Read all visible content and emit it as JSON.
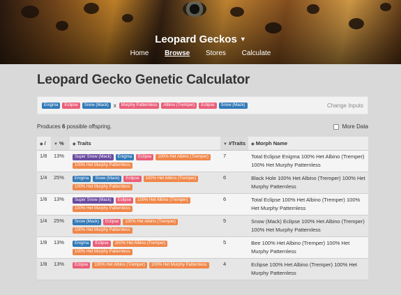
{
  "header": {
    "title": "Leopard Geckos",
    "nav": [
      "Home",
      "Browse",
      "Stores",
      "Calculate"
    ],
    "active": "Browse"
  },
  "page_title": "Leopard Gecko Genetic Calculator",
  "inputs": {
    "parent1": [
      {
        "label": "Enigma",
        "color": "#337ab7"
      },
      {
        "label": "Eclipse",
        "color": "#ea5f79"
      },
      {
        "label": "Snow (Mack)",
        "color": "#337ab7"
      }
    ],
    "cross_symbol": "x",
    "parent2": [
      {
        "label": "Murphy Patternless",
        "color": "#ea5f79"
      },
      {
        "label": "Albino (Tremper)",
        "color": "#ea5f79"
      },
      {
        "label": "Eclipse",
        "color": "#ea5f79"
      },
      {
        "label": "Snow (Mack)",
        "color": "#337ab7"
      }
    ],
    "change_label": "Change Inputs"
  },
  "summary": {
    "prefix": "Produces ",
    "count": "6",
    "suffix": " possible offspring.",
    "more_data_label": "More Data"
  },
  "table": {
    "headers": {
      "prob": "/",
      "pct": "%",
      "traits": "Traits",
      "num_traits": "#Traits",
      "morph": "Morph Name"
    },
    "rows": [
      {
        "prob": "1/8",
        "pct": "13%",
        "num_traits": "7",
        "traits": [
          {
            "label": "Super Snow (Mack)",
            "color": "#6a4aa0"
          },
          {
            "label": "Enigma",
            "color": "#337ab7"
          },
          {
            "label": "Eclipse",
            "color": "#ea5f79"
          },
          {
            "label": "100% Het Albino (Tremper)",
            "color": "#f0874a"
          },
          {
            "label": "100% Het Murphy Patternless",
            "color": "#f0874a"
          }
        ],
        "morph": "Total Eclipse Enigma 100% Het Albino (Tremper) 100% Het Murphy Patternless"
      },
      {
        "prob": "1/4",
        "pct": "25%",
        "num_traits": "6",
        "traits": [
          {
            "label": "Enigma",
            "color": "#337ab7"
          },
          {
            "label": "Snow (Mack)",
            "color": "#337ab7"
          },
          {
            "label": "Eclipse",
            "color": "#ea5f79"
          },
          {
            "label": "100% Het Albino (Tremper)",
            "color": "#f0874a"
          },
          {
            "label": "100% Het Murphy Patternless",
            "color": "#f0874a"
          }
        ],
        "morph": "Black Hole 100% Het Albino (Tremper) 100% Het Murphy Patternless"
      },
      {
        "prob": "1/8",
        "pct": "13%",
        "num_traits": "6",
        "traits": [
          {
            "label": "Super Snow (Mack)",
            "color": "#6a4aa0"
          },
          {
            "label": "Eclipse",
            "color": "#ea5f79"
          },
          {
            "label": "100% Het Albino (Tremper)",
            "color": "#f0874a"
          },
          {
            "label": "100% Het Murphy Patternless",
            "color": "#f0874a"
          }
        ],
        "morph": "Total Eclipse 100% Het Albino (Tremper) 100% Het Murphy Patternless"
      },
      {
        "prob": "1/4",
        "pct": "25%",
        "num_traits": "5",
        "traits": [
          {
            "label": "Snow (Mack)",
            "color": "#337ab7"
          },
          {
            "label": "Eclipse",
            "color": "#ea5f79"
          },
          {
            "label": "100% Het Albino (Tremper)",
            "color": "#f0874a"
          },
          {
            "label": "100% Het Murphy Patternless",
            "color": "#f0874a"
          }
        ],
        "morph": "Snow (Mack) Eclipse 100% Het Albino (Tremper) 100% Het Murphy Patternless"
      },
      {
        "prob": "1/8",
        "pct": "13%",
        "num_traits": "5",
        "traits": [
          {
            "label": "Enigma",
            "color": "#337ab7"
          },
          {
            "label": "Eclipse",
            "color": "#ea5f79"
          },
          {
            "label": "100% Het Albino (Tremper)",
            "color": "#f0874a"
          },
          {
            "label": "100% Het Murphy Patternless",
            "color": "#f0874a"
          }
        ],
        "morph": "Bee 100% Het Albino (Tremper) 100% Het Murphy Patternless"
      },
      {
        "prob": "1/8",
        "pct": "13%",
        "num_traits": "4",
        "traits": [
          {
            "label": "Eclipse",
            "color": "#ea5f79"
          },
          {
            "label": "100% Het Albino (Tremper)",
            "color": "#f0874a"
          },
          {
            "label": "100% Het Murphy Patternless",
            "color": "#f0874a"
          }
        ],
        "morph": "Eclipse 100% Het Albino (Tremper) 100% Het Murphy Patternless"
      }
    ]
  }
}
